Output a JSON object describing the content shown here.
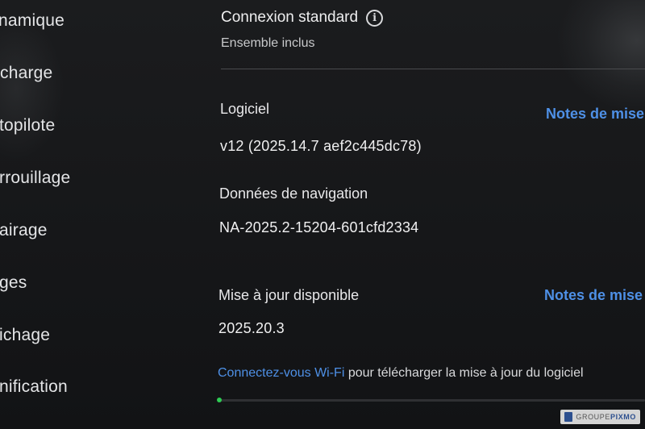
{
  "sidebar": {
    "items": [
      {
        "label": "namique"
      },
      {
        "label": "charge"
      },
      {
        "label": "topilote"
      },
      {
        "label": "rrouillage"
      },
      {
        "label": "airage"
      },
      {
        "label": "ges"
      },
      {
        "label": "ichage"
      },
      {
        "label": "nification"
      }
    ]
  },
  "connection": {
    "title": "Connexion standard",
    "info_icon": "info-circle-icon",
    "subtitle": "Ensemble inclus"
  },
  "software": {
    "label": "Logiciel",
    "version": "v12 (2025.14.7 aef2c445dc78)",
    "release_notes_link": "Notes de mise"
  },
  "navigation_data": {
    "label": "Données de navigation",
    "value": "NA-2025.2-15204-601cfd2334"
  },
  "update": {
    "label": "Mise à jour disponible",
    "version": "2025.20.3",
    "release_notes_link": "Notes de mise",
    "wifi_link": "Connectez-vous Wi-Fi",
    "wifi_text": " pour télécharger la mise à jour du logiciel",
    "progress": 0.0
  },
  "watermark": {
    "text_prefix": "GROUPE",
    "text_brand": "PIXMO"
  },
  "colors": {
    "link": "#4e90e6",
    "progress_dot": "#2ecc54",
    "background": "#161719"
  }
}
